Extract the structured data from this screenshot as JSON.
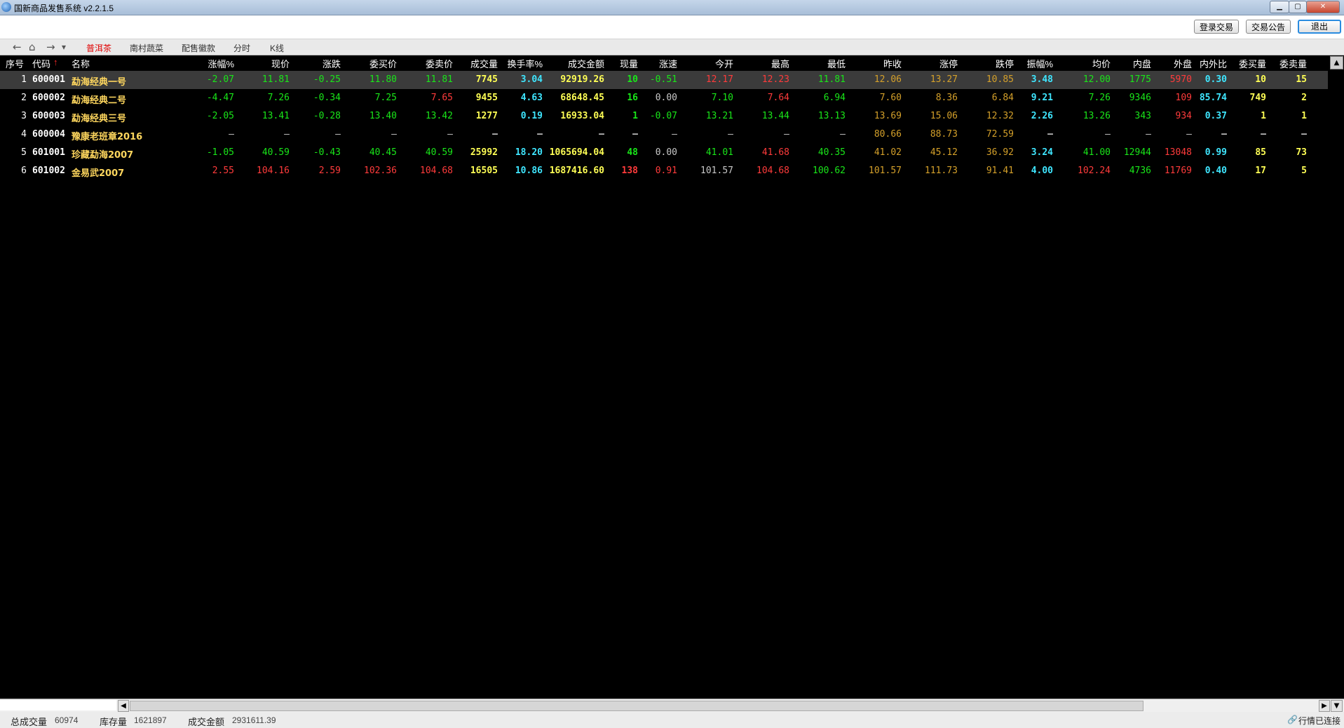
{
  "window": {
    "title": "国新商品发售系统 v2.2.1.5",
    "min_label": "▁",
    "max_label": "▢",
    "close_label": "✕"
  },
  "toolbar": {
    "login_trade": "登录交易",
    "trade_notice": "交易公告",
    "exit": "退出"
  },
  "nav": {
    "back_icon": "←",
    "home_icon": "⌂",
    "forward_icon": "→",
    "dropdown_icon": "▾",
    "tabs": [
      "普洱茶",
      "南村蔬菜",
      "配售徽款",
      "分时",
      "K线"
    ],
    "active_tab": 0
  },
  "grid": {
    "headers": {
      "idx": "序号",
      "code": "代码",
      "sort_indicator": "↑",
      "name": "名称",
      "chg_pct": "涨幅%",
      "price": "现价",
      "chg": "涨跌",
      "bid": "委买价",
      "ask": "委卖价",
      "volume": "成交量",
      "turnover": "换手率%",
      "amount": "成交金额",
      "cur_vol": "现量",
      "speed": "涨速",
      "open": "今开",
      "high": "最高",
      "low": "最低",
      "prev_close": "昨收",
      "limit_up": "涨停",
      "limit_down": "跌停",
      "amplitude": "振幅%",
      "avg": "均价",
      "inner": "内盘",
      "outer": "外盘",
      "io_ratio": "内外比",
      "bid_vol": "委买量",
      "ask_vol": "委卖量"
    },
    "rows": [
      {
        "idx": "1",
        "code": "600001",
        "name": "勐海经典一号",
        "chg_pct": "-2.07",
        "price": "11.81",
        "chg": "-0.25",
        "bid": "11.80",
        "ask": "11.81",
        "volume": "7745",
        "turnover": "3.04",
        "amount": "92919.26",
        "cur_vol": "10",
        "speed": "-0.51",
        "open": "12.17",
        "high": "12.23",
        "low": "11.81",
        "prev_close": "12.06",
        "limit_up": "13.27",
        "limit_down": "10.85",
        "amplitude": "3.48",
        "avg": "12.00",
        "inner": "1775",
        "outer": "5970",
        "io_ratio": "0.30",
        "bid_vol": "10",
        "ask_vol": "15"
      },
      {
        "idx": "2",
        "code": "600002",
        "name": "勐海经典二号",
        "chg_pct": "-4.47",
        "price": "7.26",
        "chg": "-0.34",
        "bid": "7.25",
        "ask": "7.65",
        "volume": "9455",
        "turnover": "4.63",
        "amount": "68648.45",
        "cur_vol": "16",
        "speed": "0.00",
        "open": "7.10",
        "high": "7.64",
        "low": "6.94",
        "prev_close": "7.60",
        "limit_up": "8.36",
        "limit_down": "6.84",
        "amplitude": "9.21",
        "avg": "7.26",
        "inner": "9346",
        "outer": "109",
        "io_ratio": "85.74",
        "bid_vol": "749",
        "ask_vol": "2"
      },
      {
        "idx": "3",
        "code": "600003",
        "name": "勐海经典三号",
        "chg_pct": "-2.05",
        "price": "13.41",
        "chg": "-0.28",
        "bid": "13.40",
        "ask": "13.42",
        "volume": "1277",
        "turnover": "0.19",
        "amount": "16933.04",
        "cur_vol": "1",
        "speed": "-0.07",
        "open": "13.21",
        "high": "13.44",
        "low": "13.13",
        "prev_close": "13.69",
        "limit_up": "15.06",
        "limit_down": "12.32",
        "amplitude": "2.26",
        "avg": "13.26",
        "inner": "343",
        "outer": "934",
        "io_ratio": "0.37",
        "bid_vol": "1",
        "ask_vol": "1"
      },
      {
        "idx": "4",
        "code": "600004",
        "name": "豫康老班章2016",
        "chg_pct": "—",
        "price": "—",
        "chg": "—",
        "bid": "—",
        "ask": "—",
        "volume": "—",
        "turnover": "—",
        "amount": "—",
        "cur_vol": "—",
        "speed": "—",
        "open": "—",
        "high": "—",
        "low": "—",
        "prev_close": "80.66",
        "limit_up": "88.73",
        "limit_down": "72.59",
        "amplitude": "—",
        "avg": "—",
        "inner": "—",
        "outer": "—",
        "io_ratio": "—",
        "bid_vol": "—",
        "ask_vol": "—"
      },
      {
        "idx": "5",
        "code": "601001",
        "name": "珍藏勐海2007",
        "chg_pct": "-1.05",
        "price": "40.59",
        "chg": "-0.43",
        "bid": "40.45",
        "ask": "40.59",
        "volume": "25992",
        "turnover": "18.20",
        "amount": "1065694.04",
        "cur_vol": "48",
        "speed": "0.00",
        "open": "41.01",
        "high": "41.68",
        "low": "40.35",
        "prev_close": "41.02",
        "limit_up": "45.12",
        "limit_down": "36.92",
        "amplitude": "3.24",
        "avg": "41.00",
        "inner": "12944",
        "outer": "13048",
        "io_ratio": "0.99",
        "bid_vol": "85",
        "ask_vol": "73"
      },
      {
        "idx": "6",
        "code": "601002",
        "name": "金易武2007",
        "chg_pct": "2.55",
        "price": "104.16",
        "chg": "2.59",
        "bid": "102.36",
        "ask": "104.68",
        "volume": "16505",
        "turnover": "10.86",
        "amount": "1687416.60",
        "cur_vol": "138",
        "speed": "0.91",
        "open": "101.57",
        "high": "104.68",
        "low": "100.62",
        "prev_close": "101.57",
        "limit_up": "111.73",
        "limit_down": "91.41",
        "amplitude": "4.00",
        "avg": "102.24",
        "inner": "4736",
        "outer": "11769",
        "io_ratio": "0.40",
        "bid_vol": "17",
        "ask_vol": "5"
      }
    ],
    "selected_row": 0
  },
  "colors": {
    "up": "#ff3b3b",
    "down": "#19e619",
    "flat": "#c8c8c8",
    "name": "#ffd75e",
    "volume": "#ffff55",
    "turnover": "#3fe6ff",
    "prev_close": "#d4a02a",
    "limit": "#d4a02a",
    "white": "#ffffff"
  },
  "scrollbars": {
    "up_arrow": "▲",
    "left_arrow": "◀",
    "right_arrow": "▶",
    "down_arrow": "▼"
  },
  "status": {
    "total_volume_label": "总成交量",
    "total_volume_value": "60974",
    "inventory_label": "库存量",
    "inventory_value": "1621897",
    "total_amount_label": "成交金额",
    "total_amount_value": "2931611.39",
    "connection_icon": "🔗",
    "connection_text": "行情已连接"
  }
}
